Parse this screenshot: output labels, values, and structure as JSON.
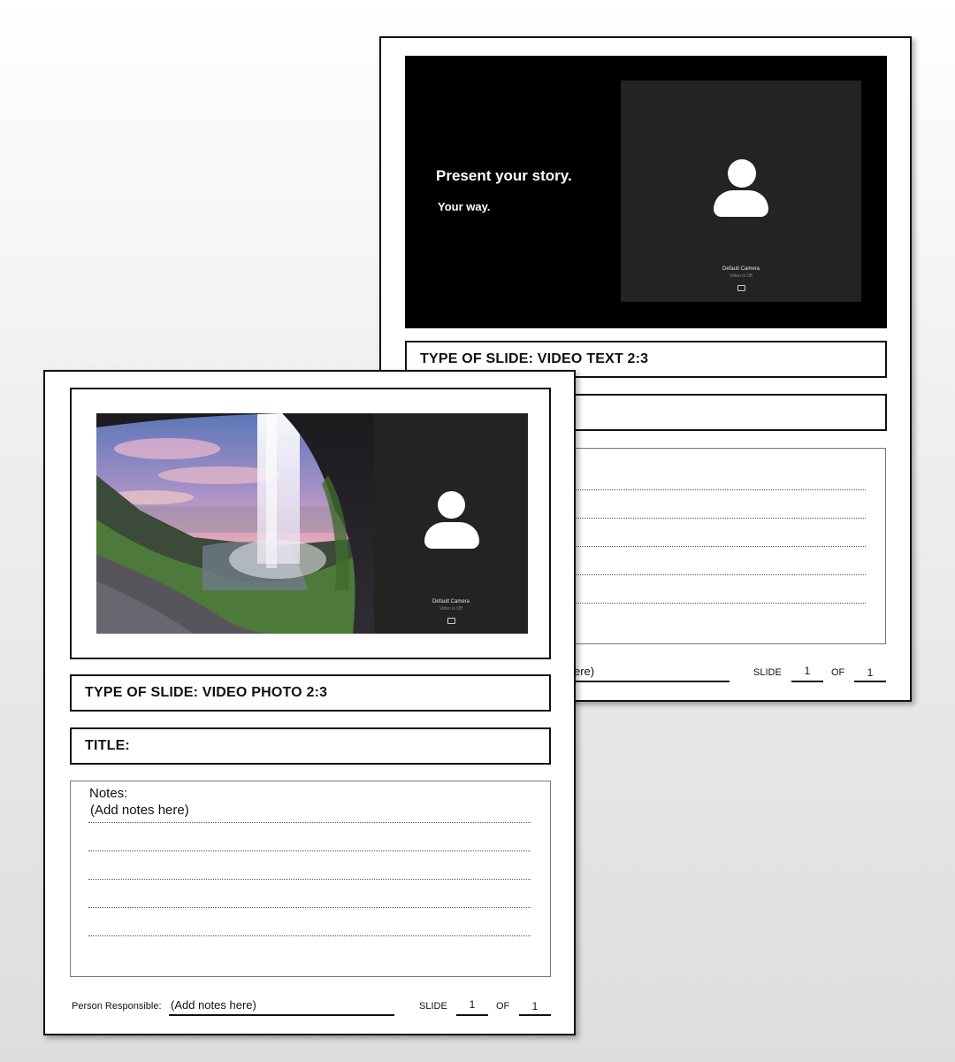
{
  "back_sheet": {
    "slide": {
      "headline": "Present your story.",
      "subhead": "Your way.",
      "camera_label": "Default Camera",
      "camera_status": "Video is Off"
    },
    "type_of_slide": "TYPE OF SLIDE: VIDEO TEXT 2:3",
    "title_label": "",
    "person_hint_fragment": "ere)",
    "slide_label": "SLIDE",
    "slide_number": "1",
    "of_label": "OF",
    "slide_total": "1"
  },
  "front_sheet": {
    "slide": {
      "camera_label": "Default Camera",
      "camera_status": "Video is Off",
      "photo_icon": "waterfall-photo"
    },
    "type_of_slide": "TYPE OF SLIDE: VIDEO PHOTO 2:3",
    "title_label": "TITLE:",
    "notes_label": "Notes:",
    "notes_placeholder": "(Add notes here)",
    "person_label": "Person Responsible:",
    "person_value": "(Add notes here)",
    "slide_label": "SLIDE",
    "slide_number": "1",
    "of_label": "OF",
    "slide_total": "1"
  },
  "icons": {
    "avatar": "person-silhouette-icon",
    "camera": "camera-toggle-icon"
  }
}
